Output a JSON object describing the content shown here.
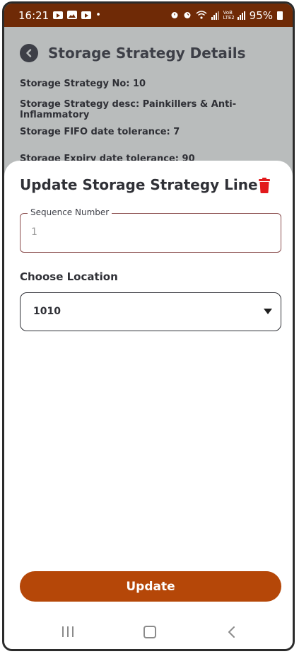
{
  "status_bar": {
    "time": "16:21",
    "dot": "•",
    "battery_percent": "95%",
    "left_icons": [
      "youtube-icon",
      "gallery-icon",
      "youtube-icon"
    ],
    "right_icons": [
      "alarm-icon",
      "wifi-icon",
      "signal-icon",
      "battery-icon"
    ],
    "network_label": "VoB LTE2"
  },
  "background_page": {
    "title": "Storage Strategy Details",
    "lines": [
      "Storage Strategy No: 10",
      "Storage Strategy desc: Painkillers & Anti-Inflammatory",
      "Storage FIFO date tolerance: 7",
      "Storage Expiry date tolerance: 90"
    ]
  },
  "sheet": {
    "title": "Update Storage Strategy Line",
    "sequence_field": {
      "label": "Sequence Number",
      "value": "1"
    },
    "location_label": "Choose Location",
    "location_select": {
      "value": "1010"
    },
    "update_label": "Update"
  },
  "colors": {
    "status_bar": "#6f2a06",
    "accent_button": "#b54708",
    "delete_icon": "#e2191c",
    "overlay": "#b9bcbc"
  }
}
